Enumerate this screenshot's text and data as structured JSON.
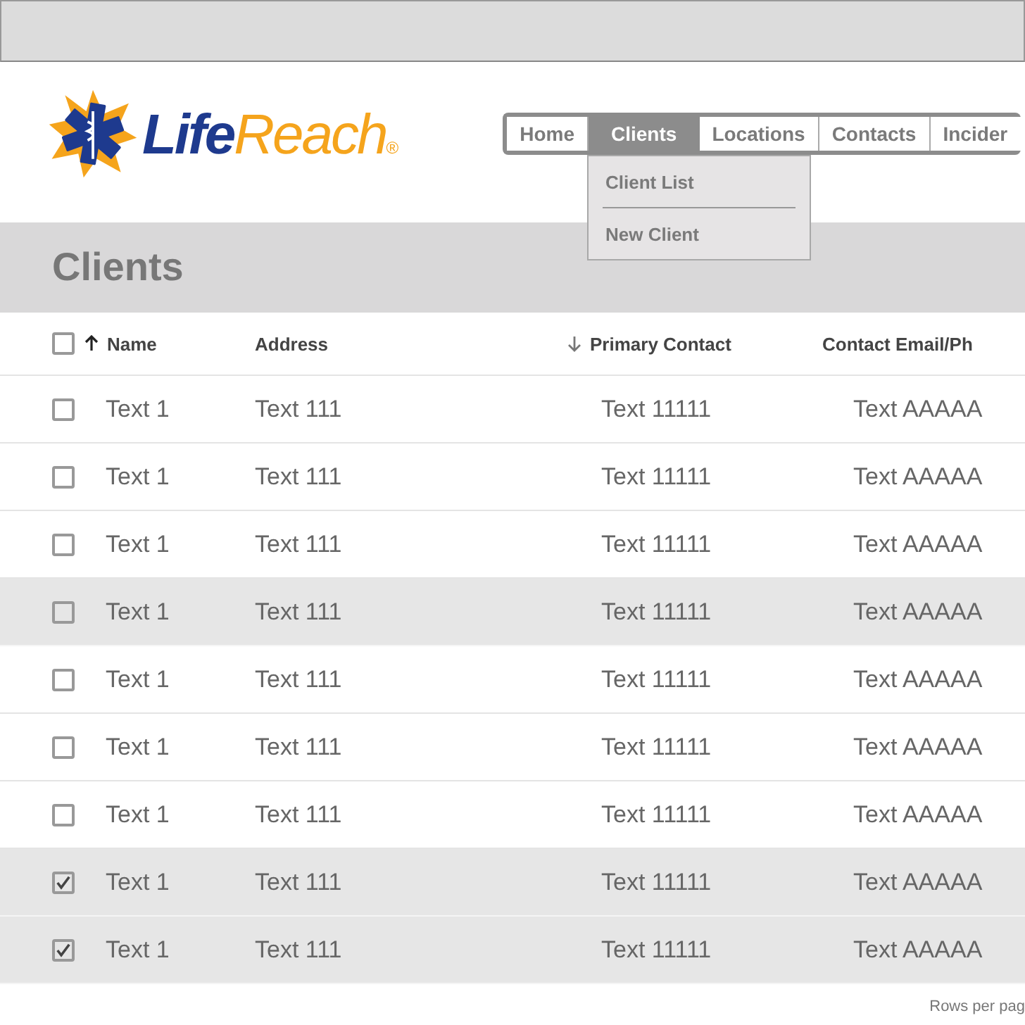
{
  "logo": {
    "part_1": "Life",
    "part_2": "Reach",
    "mark": "®"
  },
  "nav": {
    "tabs": [
      {
        "label": "Home",
        "selected": false
      },
      {
        "label": "Clients",
        "selected": true
      },
      {
        "label": "Locations",
        "selected": false
      },
      {
        "label": "Contacts",
        "selected": false
      },
      {
        "label": "Incider",
        "selected": false
      }
    ],
    "menu": [
      "Client List",
      "New Client"
    ]
  },
  "page_title": "Clients",
  "table": {
    "all_checked": false,
    "columns": [
      {
        "label": "Name",
        "kind": "ascending"
      },
      {
        "label": "Address",
        "kind": "plain"
      },
      {
        "label": "Primary Contact",
        "kind": "descending"
      },
      {
        "label": "Contact Email/Ph",
        "kind": "plain"
      }
    ],
    "rows": [
      {
        "cells": [
          "Text 1",
          "Text 111",
          "Text 11111",
          "Text AAAAA"
        ],
        "checked": false,
        "hovered": false
      },
      {
        "cells": [
          "Text 1",
          "Text 111",
          "Text 11111",
          "Text AAAAA"
        ],
        "checked": false,
        "hovered": false
      },
      {
        "cells": [
          "Text 1",
          "Text 111",
          "Text 11111",
          "Text AAAAA"
        ],
        "checked": false,
        "hovered": false
      },
      {
        "cells": [
          "Text 1",
          "Text 111",
          "Text 11111",
          "Text AAAAA"
        ],
        "checked": false,
        "hovered": true
      },
      {
        "cells": [
          "Text 1",
          "Text 111",
          "Text 11111",
          "Text AAAAA"
        ],
        "checked": false,
        "hovered": false
      },
      {
        "cells": [
          "Text 1",
          "Text 111",
          "Text 11111",
          "Text AAAAA"
        ],
        "checked": false,
        "hovered": false
      },
      {
        "cells": [
          "Text 1",
          "Text 111",
          "Text 11111",
          "Text AAAAA"
        ],
        "checked": false,
        "hovered": false
      },
      {
        "cells": [
          "Text 1",
          "Text 111",
          "Text 11111",
          "Text AAAAA"
        ],
        "checked": true,
        "hovered": true
      },
      {
        "cells": [
          "Text 1",
          "Text 111",
          "Text 11111",
          "Text AAAAA"
        ],
        "checked": true,
        "hovered": true
      }
    ]
  },
  "footer": {
    "rows_per_page_label": "Rows per pag"
  }
}
